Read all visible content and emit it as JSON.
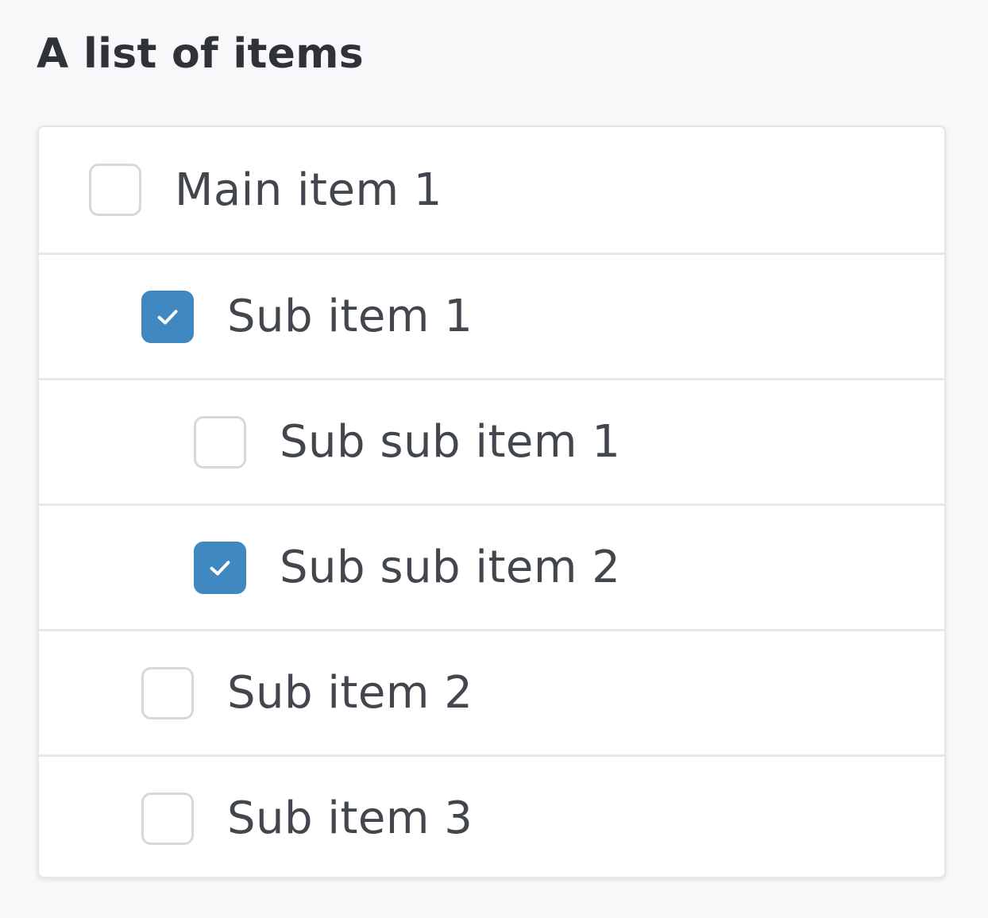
{
  "page": {
    "title": "A list of items"
  },
  "items": [
    {
      "label": "Main item 1",
      "checked": false,
      "level": 0
    },
    {
      "label": "Sub item 1",
      "checked": true,
      "level": 1
    },
    {
      "label": "Sub sub item 1",
      "checked": false,
      "level": 2
    },
    {
      "label": "Sub sub item 2",
      "checked": true,
      "level": 2
    },
    {
      "label": "Sub item 2",
      "checked": false,
      "level": 1
    },
    {
      "label": "Sub item 3",
      "checked": false,
      "level": 1
    }
  ],
  "colors": {
    "accent": "#3f88c0",
    "background": "#f8f8fa",
    "panel": "#ffffff",
    "text": "#42464d"
  },
  "icons": {
    "check": "checkmark-icon"
  }
}
